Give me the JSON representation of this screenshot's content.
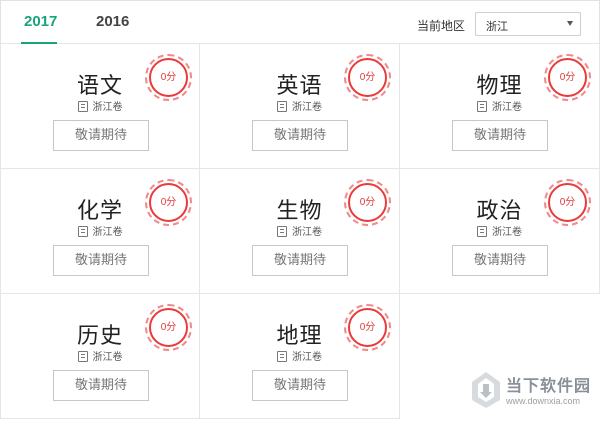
{
  "header": {
    "tabs": [
      {
        "label": "2017",
        "active": true
      },
      {
        "label": "2016",
        "active": false
      }
    ],
    "region_label": "当前地区",
    "region_value": "浙江"
  },
  "cards": [
    {
      "subject": "语文",
      "paper": "浙江卷",
      "button": "敬请期待",
      "score": "0分"
    },
    {
      "subject": "英语",
      "paper": "浙江卷",
      "button": "敬请期待",
      "score": "0分"
    },
    {
      "subject": "物理",
      "paper": "浙江卷",
      "button": "敬请期待",
      "score": "0分"
    },
    {
      "subject": "化学",
      "paper": "浙江卷",
      "button": "敬请期待",
      "score": "0分"
    },
    {
      "subject": "生物",
      "paper": "浙江卷",
      "button": "敬请期待",
      "score": "0分"
    },
    {
      "subject": "政治",
      "paper": "浙江卷",
      "button": "敬请期待",
      "score": "0分"
    },
    {
      "subject": "历史",
      "paper": "浙江卷",
      "button": "敬请期待",
      "score": "0分"
    },
    {
      "subject": "地理",
      "paper": "浙江卷",
      "button": "敬请期待",
      "score": "0分"
    }
  ],
  "watermark": {
    "name": "当下软件园",
    "url": "www.downxia.com"
  },
  "colors": {
    "accent": "#1aa37b",
    "stamp_red": "#ea3b3b"
  }
}
